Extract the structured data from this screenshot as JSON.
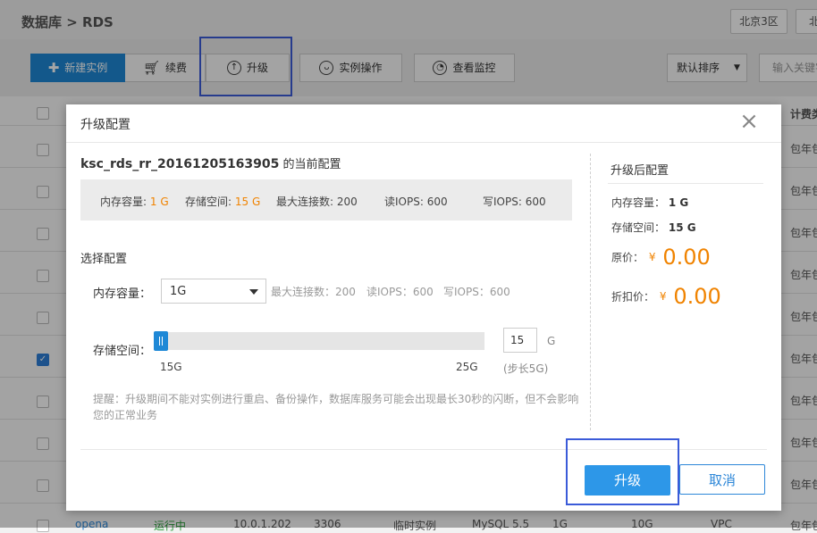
{
  "page": {
    "breadcrumb": "数据库 > RDS",
    "regions": [
      "北京3区",
      "北"
    ],
    "toolbar": {
      "create_label": "新建实例",
      "renew_label": "续费",
      "upgrade_label": "升级",
      "instance_ops_label": "实例操作",
      "monitor_label": "查看监控",
      "sort_label": "默认排序",
      "search_placeholder": "输入关键字"
    },
    "table": {
      "header_col_billing": "计费类",
      "row_billing_text": "包年包",
      "bottom_row": {
        "name": "opena",
        "status": "运行中",
        "ip": "10.0.1.202",
        "port": "3306",
        "type": "临时实例",
        "engine": "MySQL 5.5",
        "memory": "1G",
        "storage": "10G",
        "network": "VPC"
      }
    }
  },
  "modal": {
    "title": "升级配置",
    "current": {
      "instance_name": "ksc_rds_rr_20161205163905",
      "suffix": "的当前配置",
      "mem_label": "内存容量:",
      "mem_value": "1 G",
      "storage_label": "存储空间:",
      "storage_value": "15 G",
      "maxconn": "最大连接数: 200",
      "read_iops": "读IOPS: 600",
      "write_iops": "写IOPS: 600"
    },
    "select_section": {
      "title": "选择配置",
      "memory_label": "内存容量：",
      "memory_value": "1G",
      "hint_maxconn": "最大连接数：200",
      "hint_read": "读IOPS：600",
      "hint_write": "写IOPS：600",
      "storage_label": "存储空间：",
      "slider_min": "15G",
      "slider_max": "25G",
      "slider_value_fraction": 0,
      "storage_input": "15",
      "storage_unit": "G",
      "step_note": "(步长5G)",
      "warning": "提醒：升级期间不能对实例进行重启、备份操作，数据库服务可能会出现最长30秒的闪断，但不会影响您的正常业务"
    },
    "after": {
      "title": "升级后配置",
      "mem_label": "内存容量：",
      "mem_value": "1 G",
      "storage_label": "存储空间：",
      "storage_value": "15 G",
      "orig_price_label": "原价：",
      "currency": "¥",
      "orig_price": "0.00",
      "discount_price_label": "折扣价：",
      "discount_price": "0.00"
    },
    "buttons": {
      "upgrade": "升级",
      "cancel": "取消"
    }
  },
  "colors": {
    "accent": "#1e88d6",
    "price": "#f08300",
    "highlight_box": "#3b5bd9"
  }
}
